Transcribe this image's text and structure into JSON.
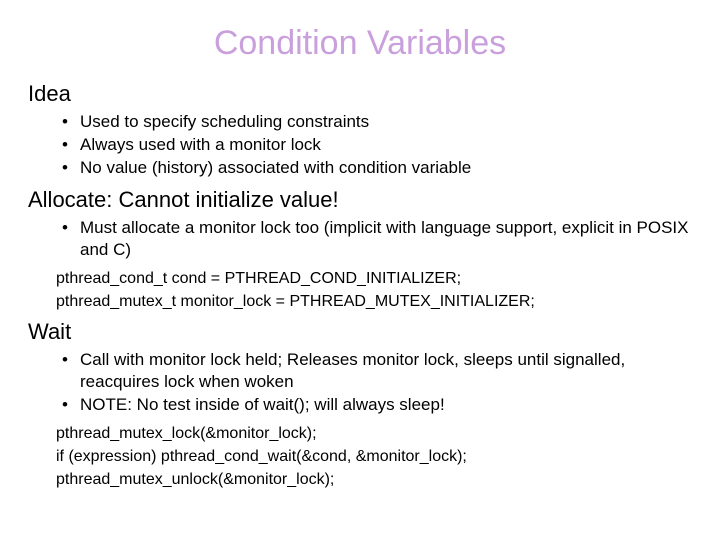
{
  "title": "Condition Variables",
  "sections": {
    "idea": {
      "heading": "Idea",
      "bullets": [
        "Used to specify scheduling constraints",
        "Always used with a monitor lock",
        "No value (history) associated with condition variable"
      ]
    },
    "allocate": {
      "heading": "Allocate: Cannot initialize value!",
      "bullets": [
        "Must allocate a monitor lock too (implicit with language support, explicit in POSIX and C)"
      ],
      "code": [
        "pthread_cond_t cond = PTHREAD_COND_INITIALIZER;",
        "pthread_mutex_t monitor_lock = PTHREAD_MUTEX_INITIALIZER;"
      ]
    },
    "wait": {
      "heading": "Wait",
      "bullets": [
        "Call with monitor lock held; Releases monitor lock, sleeps until signalled, reacquires lock when woken",
        "NOTE: No test inside of wait(); will always sleep!"
      ],
      "code": [
        "pthread_mutex_lock(&monitor_lock);",
        "if (expression) pthread_cond_wait(&cond, &monitor_lock);",
        "pthread_mutex_unlock(&monitor_lock);"
      ]
    }
  }
}
